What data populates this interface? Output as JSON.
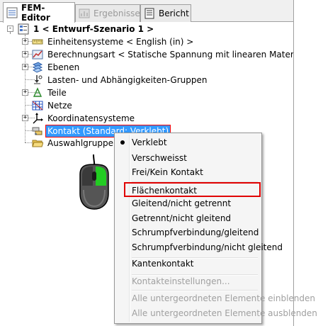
{
  "tabs": [
    {
      "label": "FEM-Editor",
      "icon": "fem-editor-icon",
      "active": true
    },
    {
      "label": "Ergebnisse",
      "icon": "results-icon",
      "disabled": true
    },
    {
      "label": "Bericht",
      "icon": "report-icon"
    }
  ],
  "tree": {
    "root": {
      "label": "1 < Entwurf-Szenario 1 >",
      "expander": "-"
    },
    "items": [
      {
        "label": "Einheitensysteme < English (in) >",
        "icon": "units-icon",
        "expander": "+"
      },
      {
        "label": "Berechnungsart < Statische Spannung mit linearen Materialn",
        "icon": "analysis-type-icon",
        "expander": "+"
      },
      {
        "label": "Ebenen",
        "icon": "layers-icon",
        "expander": "+"
      },
      {
        "label": "Lasten- und Abhängigkeiten-Gruppen",
        "icon": "loads-icon",
        "expander": ""
      },
      {
        "label": "Teile",
        "icon": "parts-icon",
        "expander": "+"
      },
      {
        "label": "Netze",
        "icon": "mesh-icon",
        "expander": ""
      },
      {
        "label": "Koordinatensysteme",
        "icon": "coordinate-system-icon",
        "expander": "+"
      },
      {
        "label": "Kontakt (Standard: Verklebt)",
        "icon": "contact-icon",
        "expander": ""
      },
      {
        "label": "Auswahlgruppen",
        "icon": "folder-icon",
        "expander": ""
      }
    ]
  },
  "context_menu": {
    "items": [
      {
        "label": "Verklebt",
        "checked": true
      },
      {
        "label": "Verschweisst"
      },
      {
        "label": "Frei/Kein Kontakt"
      },
      {
        "separator": true
      },
      {
        "label": "Flächenkontakt",
        "highlighted": true
      },
      {
        "label": "Gleitend/nicht getrennt"
      },
      {
        "label": "Getrennt/nicht gleitend"
      },
      {
        "label": "Schrumpfverbindung/gleitend"
      },
      {
        "label": "Schrumpfverbindung/nicht gleitend"
      },
      {
        "separator": true
      },
      {
        "label": "Kantenkontakt"
      },
      {
        "separator": true
      },
      {
        "label": "Kontakteinstellungen...",
        "disabled": true
      },
      {
        "separator": true
      },
      {
        "label": "Alle untergeordneten Elemente einblenden",
        "disabled": true
      },
      {
        "label": "Alle untergeordneten Elemente ausblenden",
        "disabled": true
      }
    ]
  },
  "colors": {
    "selection": "#3399ff",
    "highlight_border": "#e00000",
    "mouse_button_active": "#22cc22"
  }
}
